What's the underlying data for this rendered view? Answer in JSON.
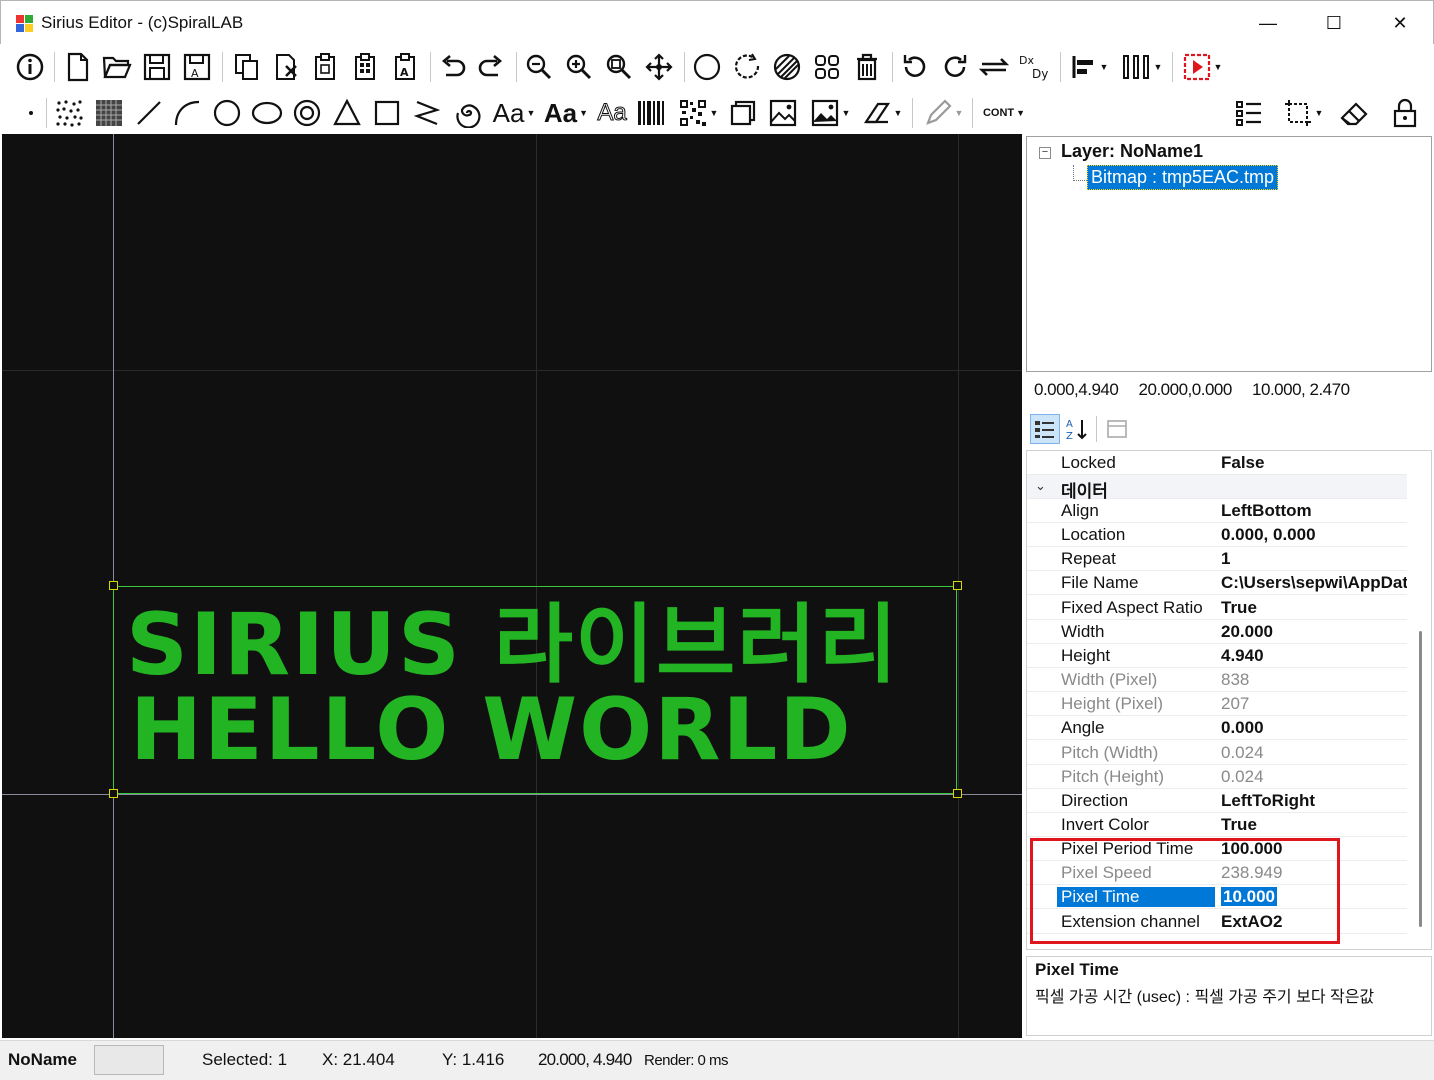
{
  "window": {
    "title": "Sirius Editor - (c)SpiralLAB",
    "minimize_label": "—",
    "maximize_label": "☐",
    "close_label": "✕"
  },
  "toolbar2": {
    "text_tool_label": "Aa",
    "text_bold_tool_label": "Aa",
    "text_outline_tool_label": "Aa",
    "cont_label": "CONT"
  },
  "canvas": {
    "bitmap_line1": "SIRIUS 라이브러리",
    "bitmap_line2": "HELLO  WORLD"
  },
  "tree": {
    "layer_label": "Layer: NoName1",
    "bitmap_label": "Bitmap : tmp5EAC.tmp"
  },
  "bounds": {
    "min": "0.000,4.940",
    "max": "20.000,0.000",
    "center": "10.000, 2.470"
  },
  "properties": {
    "locked": {
      "name": "Locked",
      "value": "False"
    },
    "category": "데이터",
    "rows": [
      {
        "name": "Align",
        "value": "LeftBottom",
        "readonly": false
      },
      {
        "name": "Location",
        "value": "0.000, 0.000",
        "readonly": false
      },
      {
        "name": "Repeat",
        "value": "1",
        "readonly": false
      },
      {
        "name": "File Name",
        "value": "C:\\Users\\sepwi\\AppDat",
        "readonly": false
      },
      {
        "name": "Fixed Aspect Ratio",
        "value": "True",
        "readonly": false
      },
      {
        "name": "Width",
        "value": "20.000",
        "readonly": false
      },
      {
        "name": "Height",
        "value": "4.940",
        "readonly": false
      },
      {
        "name": "Width (Pixel)",
        "value": "838",
        "readonly": true
      },
      {
        "name": "Height (Pixel)",
        "value": "207",
        "readonly": true
      },
      {
        "name": "Angle",
        "value": "0.000",
        "readonly": false
      },
      {
        "name": "Pitch (Width)",
        "value": "0.024",
        "readonly": true
      },
      {
        "name": "Pitch (Height)",
        "value": "0.024",
        "readonly": true
      },
      {
        "name": "Direction",
        "value": "LeftToRight",
        "readonly": false
      },
      {
        "name": "Invert Color",
        "value": "True",
        "readonly": false
      },
      {
        "name": "Pixel Period Time",
        "value": "100.000",
        "readonly": false
      },
      {
        "name": "Pixel Speed",
        "value": "238.949",
        "readonly": true
      },
      {
        "name": "Pixel Time",
        "value": "10.000",
        "readonly": false,
        "selected": true
      },
      {
        "name": "Extension channel",
        "value": "ExtAO2",
        "readonly": false
      }
    ]
  },
  "description": {
    "title": "Pixel Time",
    "text": "픽셀 가공 시간 (usec) : 픽셀 가공 주기 보다 작은값"
  },
  "status": {
    "document_name": "NoName",
    "selected": "Selected: 1",
    "x": "X: 21.404",
    "y": "Y: 1.416",
    "size": "20.000, 4.940",
    "render": "Render: 0 ms"
  },
  "colors": {
    "canvas_bg": "#101010",
    "bitmap_green": "#22b422",
    "selection_blue": "#0078d7",
    "highlight_red": "#e0161f"
  }
}
